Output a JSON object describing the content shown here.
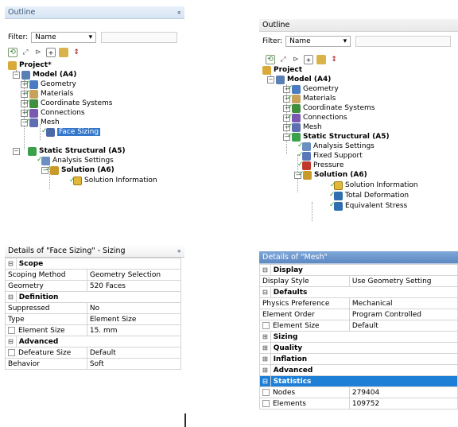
{
  "left": {
    "outline_title": "Outline",
    "pin_glyph": "ᵩ",
    "filter_label": "Filter:",
    "filter_value": "Name",
    "tree": {
      "project": "Project*",
      "model": "Model (A4)",
      "geometry": "Geometry",
      "materials": "Materials",
      "coordinate_systems": "Coordinate Systems",
      "connections": "Connections",
      "mesh": "Mesh",
      "face_sizing": "Face Sizing",
      "static_structural": "Static Structural (A5)",
      "analysis_settings": "Analysis Settings",
      "solution": "Solution (A6)",
      "solution_information": "Solution Information"
    },
    "details_title": "Details of \"Face Sizing\" - Sizing",
    "details_pin": "ᵩ",
    "details": {
      "scope": "Scope",
      "scoping_method_label": "Scoping Method",
      "scoping_method_value": "Geometry Selection",
      "geometry_label": "Geometry",
      "geometry_value": "520 Faces",
      "definition": "Definition",
      "suppressed_label": "Suppressed",
      "suppressed_value": "No",
      "type_label": "Type",
      "type_value": "Element Size",
      "element_size_label": "Element Size",
      "element_size_value": "15. mm",
      "advanced": "Advanced",
      "defeature_label": "Defeature Size",
      "defeature_value": "Default",
      "behavior_label": "Behavior",
      "behavior_value": "Soft"
    }
  },
  "right": {
    "outline_title": "Outline",
    "filter_label": "Filter:",
    "filter_value": "Name",
    "tree": {
      "project": "Project",
      "model": "Model (A4)",
      "geometry": "Geometry",
      "materials": "Materials",
      "coordinate_systems": "Coordinate Systems",
      "connections": "Connections",
      "mesh": "Mesh",
      "static_structural": "Static Structural (A5)",
      "analysis_settings": "Analysis Settings",
      "fixed_support": "Fixed Support",
      "pressure": "Pressure",
      "solution": "Solution (A6)",
      "solution_information": "Solution Information",
      "total_deformation": "Total Deformation",
      "equivalent_stress": "Equivalent Stress"
    },
    "details_title": "Details of \"Mesh\"",
    "details": {
      "display": "Display",
      "display_style_label": "Display Style",
      "display_style_value": "Use Geometry Setting",
      "defaults": "Defaults",
      "physics_label": "Physics Preference",
      "physics_value": "Mechanical",
      "element_order_label": "Element Order",
      "element_order_value": "Program Controlled",
      "element_size_label": "Element Size",
      "element_size_value": "Default",
      "sizing": "Sizing",
      "quality": "Quality",
      "inflation": "Inflation",
      "advanced": "Advanced",
      "statistics": "Statistics",
      "nodes_label": "Nodes",
      "nodes_value": "279404",
      "elements_label": "Elements",
      "elements_value": "109752"
    }
  },
  "icons": {
    "project": "#d9a93a",
    "model": "#5a7fb5",
    "geometry": "#4a7cc4",
    "materials": "#c8a25a",
    "coords": "#3f8f3f",
    "connections": "#7a5ab0",
    "mesh": "#5d6fb0",
    "static": "#3aa04a",
    "solution": "#c89a2a",
    "info": "#e2b83a"
  }
}
